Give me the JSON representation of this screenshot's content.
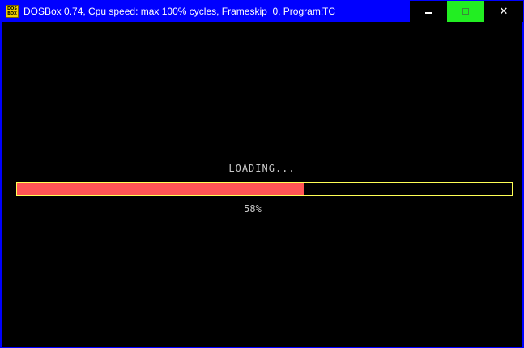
{
  "window": {
    "title": "DOSBox 0.74, Cpu speed: max 100% cycles, Frameskip  0, Program:",
    "program": "TC",
    "icon_text": "DOS BOX",
    "icon": "dosbox-icon",
    "colors": {
      "titlebar": "#0000ff",
      "maximize_button": "#22ee22",
      "screen_background": "#000000"
    }
  },
  "screen": {
    "loading_text": "LOADING...",
    "progress": {
      "percent": 58,
      "label": "58%",
      "fill_color": "#ff5555",
      "border_color": "#ffff55"
    }
  }
}
